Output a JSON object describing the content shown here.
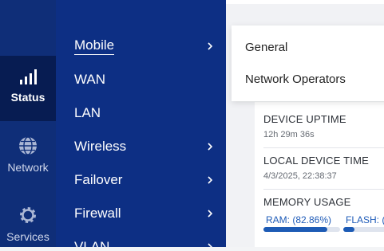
{
  "rail": {
    "items": [
      {
        "label": "Status",
        "icon": "signal-bars-icon",
        "active": true
      },
      {
        "label": "Network",
        "icon": "globe-icon",
        "active": false
      },
      {
        "label": "Services",
        "icon": "gear-icon",
        "active": false
      }
    ]
  },
  "subnav": {
    "items": [
      {
        "label": "Mobile",
        "has_children": true,
        "selected": true
      },
      {
        "label": "WAN",
        "has_children": false
      },
      {
        "label": "LAN",
        "has_children": false
      },
      {
        "label": "Wireless",
        "has_children": true
      },
      {
        "label": "Failover",
        "has_children": true
      },
      {
        "label": "Firewall",
        "has_children": true
      },
      {
        "label": "VLAN",
        "has_children": true
      }
    ]
  },
  "popover": {
    "items": [
      "General",
      "Network Operators"
    ]
  },
  "device": {
    "uptime_title": "DEVICE UPTIME",
    "uptime_value": "12h 29m 36s",
    "time_title": "LOCAL DEVICE TIME",
    "time_value": "4/3/2025, 22:38:37",
    "memory_title": "MEMORY USAGE",
    "ram_label": "RAM: (82.86%)",
    "ram_percent": 82.86,
    "flash_label": "FLASH: (",
    "flash_percent": 10
  },
  "colors": {
    "rail_bg": "#0f2e78",
    "rail_active_bg": "#071c52",
    "subnav_bg": "#0d2f84",
    "accent": "#1d5bb5"
  }
}
